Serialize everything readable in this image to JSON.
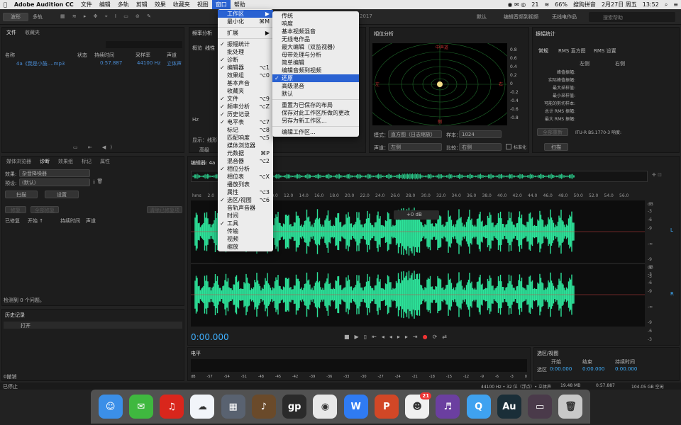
{
  "menubar": {
    "apple": "",
    "app": "Adobe Audition CC",
    "items": [
      "文件",
      "编辑",
      "多轨",
      "剪辑",
      "效果",
      "收藏夹",
      "视图",
      "窗口",
      "帮助"
    ],
    "right": {
      "battery": "66%",
      "input": "搜狗拼音",
      "date": "2月27日 周五",
      "time": "13:52",
      "badge": "21"
    }
  },
  "toolbar": {
    "waveform": "波形",
    "multitrack": "多轨",
    "workspaces": [
      "默认",
      "编辑音频到视频",
      "无线电作品"
    ],
    "search_placeholder": "搜索帮助",
    "file_title": "2017"
  },
  "files_panel": {
    "tabs": [
      "文件",
      "收藏夹"
    ],
    "columns": [
      "名称",
      "状态",
      "持续时间",
      "采样率",
      "声道"
    ],
    "file": {
      "name": "4a《我是小鼓....mp3",
      "duration": "0:57.887",
      "rate": "44100 Hz",
      "channels": "立体声"
    }
  },
  "spectrum": {
    "title": "频率分析",
    "tabs": [
      "概览",
      "线性"
    ],
    "label_hz": "Hz",
    "display": "显示：线形",
    "high": "高级"
  },
  "phase": {
    "title": "相位分析",
    "top": "中声道",
    "left": "左",
    "right": "右",
    "bottom": "侧",
    "scale": [
      "0.8",
      "0.6",
      "0.4",
      "0.2",
      "0",
      "-0.2",
      "-0.4",
      "-0.6",
      "-0.8"
    ],
    "mode_label": "模式：",
    "mode": "直方图（日志缩放）",
    "samples_label": "样本：",
    "samples": "1024",
    "channel_label": "声道：",
    "channel": "左侧",
    "ratio_label": "比较：",
    "ratio": "右侧",
    "normalize": "标准化"
  },
  "amp_stats": {
    "title": "振幅统计",
    "tabs": [
      "常规",
      "RMS 直方图",
      "RMS 设置"
    ],
    "cols": [
      "左侧",
      "右侧"
    ],
    "rows": [
      "峰值振幅:",
      "实际峰值振幅:",
      "最大采样值:",
      "最小采样值:",
      "可能的剪切样本:",
      "总计 RMS 振幅:",
      "最大 RMS 振幅:"
    ],
    "all_time": "全部重新",
    "itu": "ITU-R BS.1770-3 响度:",
    "scan": "扫描"
  },
  "diag": {
    "tabs": [
      "媒体浏览器",
      "诊断",
      "效果组",
      "标记",
      "属性"
    ],
    "effect_label": "效果:",
    "effect": "杂音降噪器",
    "preset_label": "预设:",
    "preset": "(默认)",
    "scan": "扫描",
    "settings": "设置",
    "repair": "修复",
    "repair_all": "全部修复",
    "clear": "清除已修复项",
    "cols": [
      "已修复",
      "开始 ↑",
      "持续时间",
      "声道"
    ],
    "found": "检测到 0 个问题。"
  },
  "history": {
    "title": "历史记录",
    "item": "打开",
    "undo": "0撤销"
  },
  "editor": {
    "title": "编辑器: 4a《我是...",
    "ruler": [
      "hms",
      "2.0",
      "4.0",
      "6.0",
      "8.0",
      "10.0",
      "12.0",
      "14.0",
      "16.0",
      "18.0",
      "20.0",
      "22.0",
      "24.0",
      "26.0",
      "28.0",
      "30.0",
      "32.0",
      "34.0",
      "36.0",
      "38.0",
      "40.0",
      "42.0",
      "44.0",
      "46.0",
      "48.0",
      "50.0",
      "52.0",
      "54.0",
      "56.0"
    ],
    "db": "+0 dB",
    "db_scale": [
      "dB",
      "-3",
      "-6",
      "-9",
      "-∞",
      "-9",
      "-6",
      "-3"
    ],
    "ch_l": "L",
    "ch_r": "R",
    "time": "0:00.000"
  },
  "levels": {
    "title": "电平",
    "scale": [
      "dB",
      "-57",
      "-54",
      "-51",
      "-48",
      "-45",
      "-42",
      "-39",
      "-36",
      "-33",
      "-30",
      "-27",
      "-24",
      "-21",
      "-18",
      "-15",
      "-12",
      "-9",
      "-6",
      "-3",
      "0"
    ]
  },
  "selection": {
    "title": "选区/视图",
    "cols": [
      "开始",
      "结束",
      "持续时间"
    ],
    "row_label": "选区",
    "values": [
      "0:00.000",
      "0:00.000",
      "0:00.000"
    ]
  },
  "status": {
    "left": "已停止",
    "right": [
      "44100 Hz • 32 位（浮点）• 立体声",
      "19.48 MB",
      "0:57.887",
      "104.05 GB 空闲"
    ]
  },
  "window_menu": {
    "items": [
      {
        "label": "工作区",
        "check": false,
        "sc": "▶",
        "hl": true
      },
      {
        "label": "最小化",
        "check": false,
        "sc": "⌘M"
      },
      {
        "sep": true
      },
      {
        "label": "扩展",
        "check": false,
        "sc": "▶"
      },
      {
        "sep": true
      },
      {
        "label": "振幅统计",
        "check": true,
        "sc": ""
      },
      {
        "label": "批处理",
        "check": false,
        "sc": ""
      },
      {
        "label": "诊断",
        "check": true,
        "sc": ""
      },
      {
        "label": "编辑器",
        "check": true,
        "sc": "⌥1"
      },
      {
        "label": "效果组",
        "check": false,
        "sc": "⌥0"
      },
      {
        "label": "基本声音",
        "check": false,
        "sc": ""
      },
      {
        "label": "收藏夹",
        "check": false,
        "sc": ""
      },
      {
        "label": "文件",
        "check": true,
        "sc": "⌥9"
      },
      {
        "label": "频率分析",
        "check": true,
        "sc": "⌥Z"
      },
      {
        "label": "历史记录",
        "check": true,
        "sc": ""
      },
      {
        "label": "电平表",
        "check": true,
        "sc": "⌥7"
      },
      {
        "label": "标记",
        "check": false,
        "sc": "⌥8"
      },
      {
        "label": "匹配响度",
        "check": false,
        "sc": "⌥5"
      },
      {
        "label": "媒体浏览器",
        "check": false,
        "sc": ""
      },
      {
        "label": "元数据",
        "check": false,
        "sc": "⌘P"
      },
      {
        "label": "混音器",
        "check": false,
        "sc": "⌥2"
      },
      {
        "label": "相位分析",
        "check": true,
        "sc": ""
      },
      {
        "label": "相位表",
        "check": false,
        "sc": "⌥X"
      },
      {
        "label": "播放列表",
        "check": false,
        "sc": ""
      },
      {
        "label": "属性",
        "check": false,
        "sc": "⌥3"
      },
      {
        "label": "选区/视图",
        "check": true,
        "sc": "⌥6"
      },
      {
        "label": "音轨声音器",
        "check": false,
        "sc": ""
      },
      {
        "label": "时间",
        "check": false,
        "sc": ""
      },
      {
        "label": "工具",
        "check": true,
        "sc": ""
      },
      {
        "label": "传输",
        "check": false,
        "sc": ""
      },
      {
        "label": "视频",
        "check": false,
        "sc": ""
      },
      {
        "label": "缩放",
        "check": false,
        "sc": ""
      }
    ]
  },
  "workspace_menu": {
    "items": [
      {
        "label": "传统",
        "check": false
      },
      {
        "label": "响度",
        "check": false
      },
      {
        "label": "基本视频混音",
        "check": false
      },
      {
        "label": "无线电作品",
        "check": false
      },
      {
        "label": "最大编辑（双监视器）",
        "check": false
      },
      {
        "label": "母带处理与分析",
        "check": false
      },
      {
        "label": "简单编辑",
        "check": false
      },
      {
        "label": "编辑音频到视频",
        "check": false
      },
      {
        "label": "还原",
        "check": true,
        "hl": true
      },
      {
        "label": "高级混音",
        "check": false
      },
      {
        "label": "默认",
        "check": false
      },
      {
        "sep": true
      },
      {
        "label": "重置为已保存的布局",
        "check": false
      },
      {
        "label": "保存对此工作区所做的更改",
        "check": false
      },
      {
        "label": "另存为新工作区...",
        "check": false
      },
      {
        "sep": true
      },
      {
        "label": "编辑工作区...",
        "check": false
      }
    ]
  },
  "dock": [
    {
      "name": "finder-icon",
      "bg": "#3b8fe8",
      "glyph": "☺"
    },
    {
      "name": "wechat-icon",
      "bg": "#3fb83f",
      "glyph": "✉"
    },
    {
      "name": "netease-music-icon",
      "bg": "#d9261c",
      "glyph": "♫"
    },
    {
      "name": "baidu-netdisk-icon",
      "bg": "#f2f5fa",
      "glyph": "☁"
    },
    {
      "name": "launchpad-icon",
      "bg": "#596270",
      "glyph": "▦"
    },
    {
      "name": "garageband-icon",
      "bg": "#6a4a2a",
      "glyph": "♪"
    },
    {
      "name": "guitar-pro-icon",
      "bg": "#2a2a2a",
      "glyph": "gp"
    },
    {
      "name": "chrome-icon",
      "bg": "#e8e8e8",
      "glyph": "◉"
    },
    {
      "name": "wps-icon",
      "bg": "#2f7bf3",
      "glyph": "W"
    },
    {
      "name": "powerpoint-icon",
      "bg": "#d24726",
      "glyph": "P"
    },
    {
      "name": "qq-icon",
      "bg": "#f0f0f0",
      "glyph": "☻",
      "badge": "21"
    },
    {
      "name": "music-app-icon",
      "bg": "#6b3fa0",
      "glyph": "♬"
    },
    {
      "name": "qq-browser-icon",
      "bg": "#3fa2f0",
      "glyph": "Q"
    },
    {
      "name": "audition-icon",
      "bg": "#1a2e38",
      "glyph": "Au"
    },
    {
      "name": "screen-preview-icon",
      "bg": "#4a3a4a",
      "glyph": "▭"
    },
    {
      "name": "trash-icon",
      "bg": "#c8c8c8",
      "glyph": "🗑"
    }
  ],
  "colors": {
    "wave": "#2de39a",
    "accent": "#2a62d2"
  }
}
